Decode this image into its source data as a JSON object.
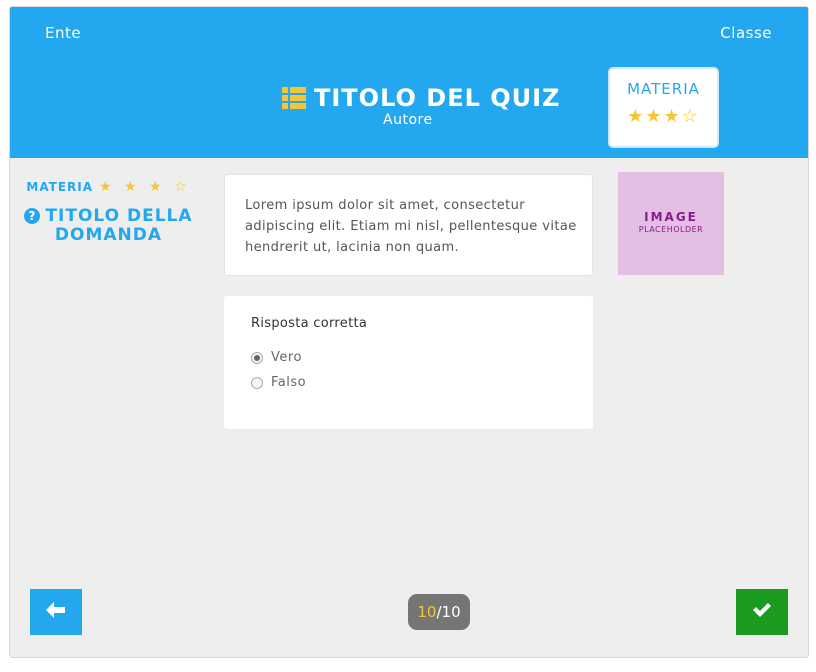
{
  "header": {
    "left_label": "Ente",
    "right_label": "Classe",
    "quiz_title": "TITOLO DEL QUIZ",
    "author": "Autore",
    "icon": "list-icon",
    "subject_card": {
      "label": "MATERIA",
      "stars": "★★★☆",
      "rating": 3,
      "max_rating": 4
    }
  },
  "question": {
    "subject": "MATERIA",
    "stars": "★ ★ ★ ☆",
    "rating": 3,
    "max_rating": 4,
    "icon": "question-circle-icon",
    "title": "TITOLO DELLA DOMANDA",
    "text": "Lorem ipsum dolor sit amet, consectetur adipiscing elit. Etiam mi nisl, pellentesque vitae hendrerit ut, lacinia non quam.",
    "image": {
      "title": "IMAGE",
      "subtitle": "PLACEHOLDER"
    }
  },
  "answer": {
    "label": "Risposta corretta",
    "options": [
      {
        "label": "Vero",
        "selected": true
      },
      {
        "label": "Falso",
        "selected": false
      }
    ]
  },
  "footer": {
    "back_icon": "arrow-left-icon",
    "confirm_icon": "checkmark-icon",
    "current_page": "10",
    "separator": "/",
    "total_pages": "10"
  },
  "colors": {
    "primary": "#23a8ef",
    "star": "#f7c533",
    "confirm": "#1a9a1f",
    "background": "#eeeeee",
    "placeholder": "#e2bfe3"
  }
}
